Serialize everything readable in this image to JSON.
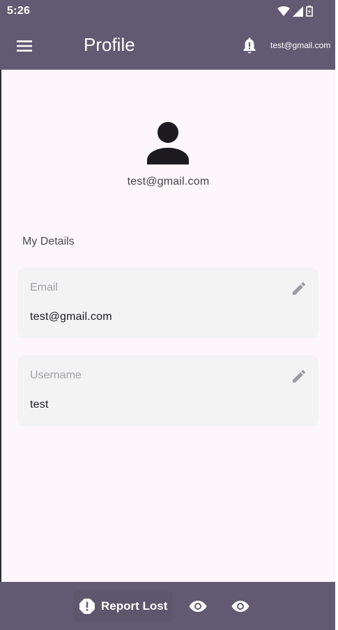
{
  "status_bar": {
    "time": "5:26",
    "icons": [
      "wifi-icon",
      "signal-icon",
      "battery-charging-icon"
    ]
  },
  "app_bar": {
    "menu_icon": "menu-icon",
    "title": "Profile",
    "notification_icon": "bell-icon",
    "user_email": "test@gmail.com"
  },
  "profile": {
    "avatar_icon": "person-icon",
    "email": "test@gmail.com"
  },
  "details": {
    "section_title": "My Details",
    "fields": [
      {
        "label": "Email",
        "value": "test@gmail.com",
        "action_icon": "edit-icon"
      },
      {
        "label": "Username",
        "value": "test",
        "action_icon": "edit-icon"
      }
    ]
  },
  "bottom_bar": {
    "report_button": {
      "label": "Report Lost",
      "icon": "alert-icon"
    },
    "actions": [
      {
        "icon": "eye-icon"
      },
      {
        "icon": "eye-icon"
      }
    ]
  },
  "colors": {
    "primary": "#625a72",
    "background": "#fdf7fb",
    "card": "#f3f3f3",
    "text": "#1d1b20",
    "muted_label": "#a3a0a6"
  }
}
